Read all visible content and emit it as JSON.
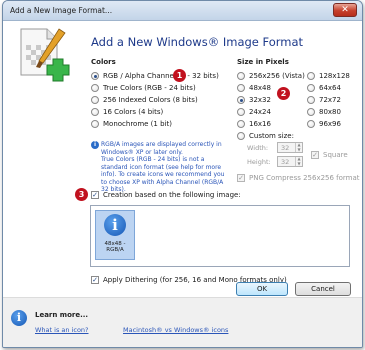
{
  "window": {
    "title": "Add a New Image Format..."
  },
  "header": {
    "title": "Add a New Windows® Image Format"
  },
  "colors": {
    "label": "Colors",
    "options": [
      "RGB / Alpha Channel (1 - 32 bits)",
      "True Colors (RGB - 24 bits)",
      "256 Indexed Colors (8 bits)",
      "16 Colors (4 bits)",
      "Monochrome (1 bit)"
    ],
    "selected_index": 0,
    "info_text": "RGB/A images are displayed correctly in Windows® XP or later only.\nTrue Colors (RGB - 24 bits) is not a standard icon format (see help for more info). To create icons we recommend you to choose XP with Alpha Channel (RGB/A 32 bits)."
  },
  "size": {
    "label": "Size in Pixels",
    "col1": [
      "256x256 (Vista)",
      "48x48",
      "32x32",
      "24x24",
      "16x16",
      "Custom size:"
    ],
    "col2": [
      "128x128",
      "64x64",
      "72x72",
      "80x80",
      "96x96"
    ],
    "selected": "32x32",
    "width_label": "Width:",
    "height_label": "Height:",
    "width_value": "32",
    "height_value": "32",
    "square_label": "Square",
    "png_compress_label": "PNG Compress 256x256 format"
  },
  "creation": {
    "label": "Creation based on the following image:",
    "checked": true,
    "image_caption": "48x48 - RGB/A",
    "image_glyph": "i"
  },
  "dithering": {
    "label": "Apply Dithering (for 256, 16 and Mono formats only)",
    "checked": true
  },
  "buttons": {
    "ok": "OK",
    "cancel": "Cancel"
  },
  "badges": [
    "1",
    "2",
    "3"
  ],
  "footer": {
    "title": "Learn more...",
    "links": [
      "What is an icon?",
      "Macintosh® vs Windows® icons"
    ]
  },
  "icons": {
    "close": "close-icon",
    "header_art": "document-brush-plus-icon",
    "info": "info-icon",
    "learn_more": "info-circle-icon"
  },
  "accent_color": "#1e3a8a",
  "badge_color": "#c1121f"
}
